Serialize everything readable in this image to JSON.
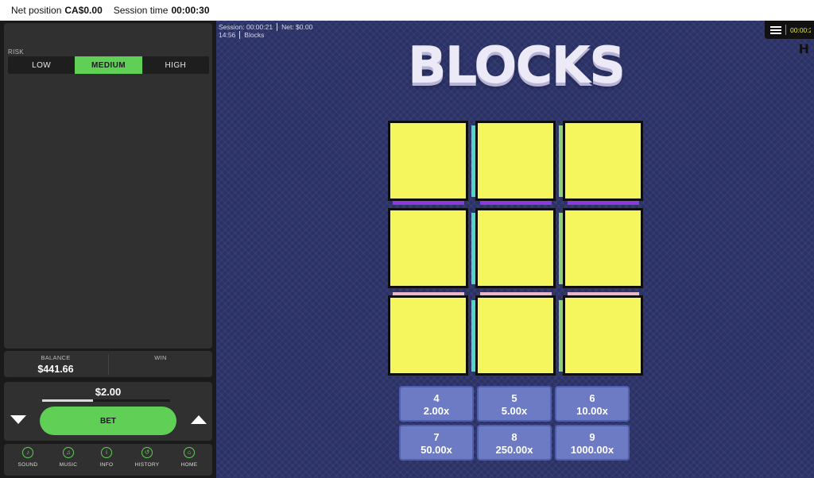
{
  "top_bar": {
    "net_position_label": "Net position",
    "net_position_value": "CA$0.00",
    "session_time_label": "Session time",
    "session_time_value": "00:00:30"
  },
  "left_panel": {
    "risk": {
      "label": "RISK",
      "options": [
        "LOW",
        "MEDIUM",
        "HIGH"
      ],
      "selected": "MEDIUM"
    },
    "balance_label": "BALANCE",
    "balance_value": "$441.66",
    "win_label": "WIN",
    "win_value": "",
    "bet_amount": "$2.00",
    "bet_slider_fraction": 0.4,
    "bet_button_label": "BET",
    "nav": [
      {
        "label": "SOUND",
        "icon": "sound-icon",
        "glyph": "♪"
      },
      {
        "label": "MUSIC",
        "icon": "music-icon",
        "glyph": "♫"
      },
      {
        "label": "INFO",
        "icon": "info-icon",
        "glyph": "i"
      },
      {
        "label": "HISTORY",
        "icon": "history-icon",
        "glyph": "↺"
      },
      {
        "label": "HOME",
        "icon": "home-icon",
        "glyph": "⌂"
      }
    ]
  },
  "game": {
    "session_info": {
      "session_label": "Session:",
      "session_value": "00:00:21",
      "net_label": "Net:",
      "net_value": "$0.00",
      "clock": "14:56",
      "game_name": "Blocks"
    },
    "top_right_timer": "00:00:2",
    "title": "BLOCKS",
    "paytable": [
      {
        "count": "4",
        "multiplier": "2.00x"
      },
      {
        "count": "5",
        "multiplier": "5.00x"
      },
      {
        "count": "6",
        "multiplier": "10.00x"
      },
      {
        "count": "7",
        "multiplier": "50.00x"
      },
      {
        "count": "8",
        "multiplier": "250.00x"
      },
      {
        "count": "9",
        "multiplier": "1000.00x"
      }
    ]
  },
  "colors": {
    "accent_green": "#5fcf55",
    "block_yellow": "#f5f55d",
    "game_background": "#2a3166",
    "paytable_cell": "#6d7bc4"
  }
}
